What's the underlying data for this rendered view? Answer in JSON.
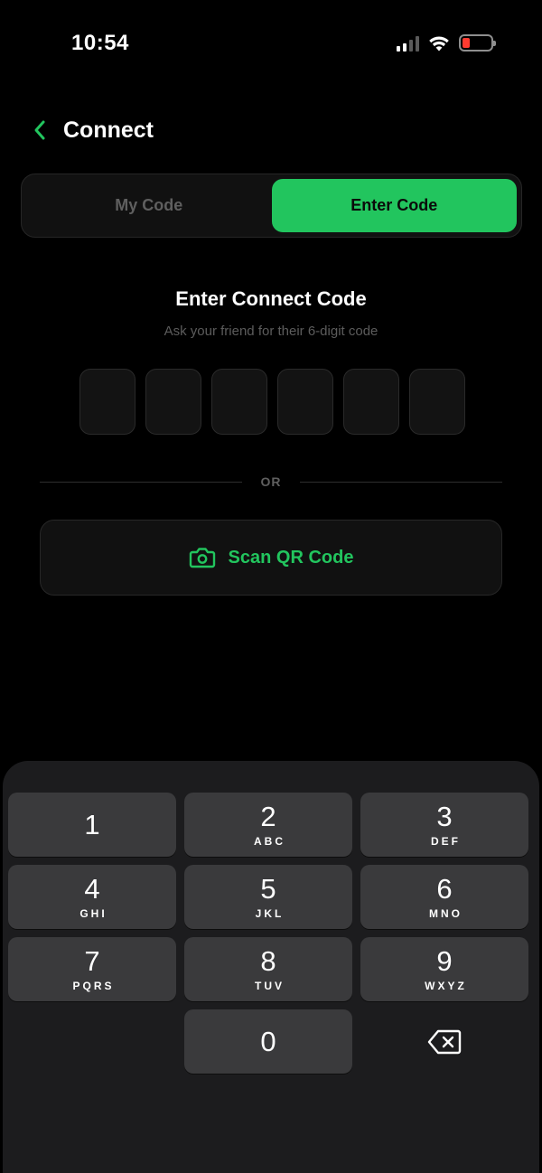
{
  "status_bar": {
    "time": "10:54",
    "signal_icon": "cellular-signal-icon",
    "wifi_icon": "wifi-icon",
    "battery_icon": "battery-low-icon",
    "battery_color": "#ff3b30"
  },
  "header": {
    "back_icon": "chevron-left-icon",
    "title": "Connect"
  },
  "tabs": [
    {
      "label": "My Code",
      "active": false
    },
    {
      "label": "Enter Code",
      "active": true
    }
  ],
  "code_entry": {
    "title": "Enter Connect Code",
    "subtitle": "Ask your friend for their 6-digit code",
    "digits": [
      "",
      "",
      "",
      "",
      "",
      ""
    ]
  },
  "divider_label": "OR",
  "scan_button": {
    "icon": "camera-icon",
    "label": "Scan QR Code"
  },
  "keypad": {
    "keys": [
      {
        "digit": "1",
        "letters": ""
      },
      {
        "digit": "2",
        "letters": "ABC"
      },
      {
        "digit": "3",
        "letters": "DEF"
      },
      {
        "digit": "4",
        "letters": "GHI"
      },
      {
        "digit": "5",
        "letters": "JKL"
      },
      {
        "digit": "6",
        "letters": "MNO"
      },
      {
        "digit": "7",
        "letters": "PQRS"
      },
      {
        "digit": "8",
        "letters": "TUV"
      },
      {
        "digit": "9",
        "letters": "WXYZ"
      },
      {
        "digit": "0",
        "letters": ""
      }
    ],
    "delete_icon": "backspace-icon"
  },
  "colors": {
    "accent": "#22c55e",
    "background": "#000000",
    "keypad_bg": "#1c1c1e",
    "key_bg": "#3a3a3c"
  }
}
